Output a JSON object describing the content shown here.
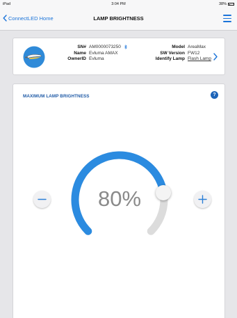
{
  "status_bar": {
    "carrier": "iPad",
    "time": "3:04 PM",
    "battery": "38%"
  },
  "nav": {
    "back_label": "ConnectLED Home",
    "title": "LAMP BRIGHTNESS"
  },
  "device": {
    "sn_label": "SN#",
    "sn_value": "AM0000073250",
    "name_label": "Name",
    "name_value": "Evluma AMAX",
    "ownerid_label": "OwnerID",
    "ownerid_value": "Evluma",
    "model_label": "Model",
    "model_value": "AreaMax",
    "sw_label": "SW Version",
    "sw_value": "FW12",
    "identify_label": "Identify Lamp",
    "identify_link": "Flash Lamp"
  },
  "brightness": {
    "title": "MAXIMUM LAMP BRIGHTNESS",
    "help": "?",
    "percent_text": "80%",
    "level": 0.8
  },
  "colors": {
    "accent": "#1a73d9",
    "arc_active": "#2b8be0",
    "arc_track": "#dcdcdc",
    "title_blue": "#1f5aa6"
  }
}
